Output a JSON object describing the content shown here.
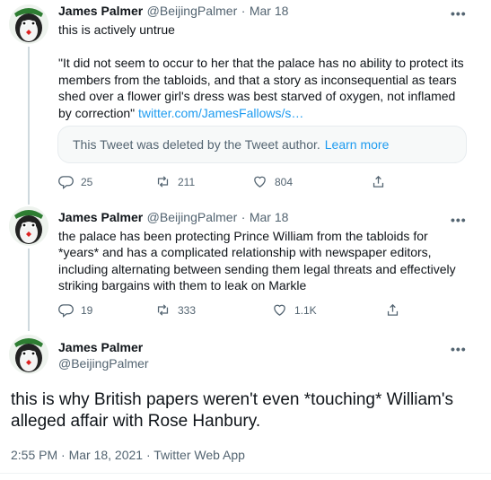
{
  "tweets": [
    {
      "author": "James Palmer",
      "handle": "@BeijingPalmer",
      "dot": "·",
      "date": "Mar 18",
      "line1": "this is actively untrue",
      "quote": "\"It did not seem to occur to her that the palace has no ability to protect its members from the tabloids, and that a story as inconsequential as tears shed over a flower girl's dress was best starved of oxygen, not inflamed by correction\"",
      "quote_link": "twitter.com/JamesFallows/s…",
      "deleted_text": "This Tweet was deleted by the Tweet author.",
      "deleted_link": "Learn more",
      "replies": "25",
      "retweets": "211",
      "likes": "804"
    },
    {
      "author": "James Palmer",
      "handle": "@BeijingPalmer",
      "dot": "·",
      "date": "Mar 18",
      "text": "the palace has been protecting Prince William from the tabloids for *years* and has a complicated relationship with newspaper editors, including alternating between sending them legal threats and effectively striking bargains with them to leak on Markle",
      "replies": "19",
      "retweets": "333",
      "likes": "1.1K"
    }
  ],
  "main": {
    "author": "James Palmer",
    "handle": "@BeijingPalmer",
    "text": "this is why British papers weren't even *touching* William's alleged affair with Rose Hanbury.",
    "meta": "2:55 PM · Mar 18, 2021 · Twitter Web App"
  },
  "more_glyph": "•••",
  "icons": [
    "reply-icon",
    "retweet-icon",
    "like-icon",
    "share-icon",
    "more-icon"
  ],
  "colors": {
    "link": "#1d9bf0",
    "muted": "#536471",
    "text": "#0f1419"
  }
}
